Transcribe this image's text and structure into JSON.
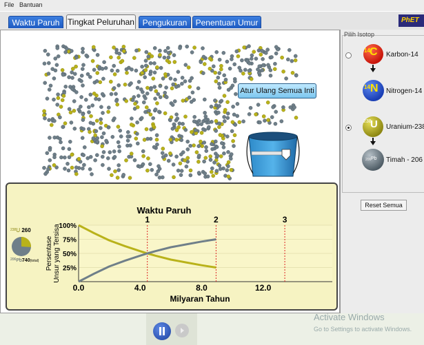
{
  "menu": {
    "file": "File",
    "help": "Bantuan"
  },
  "tabs": [
    {
      "label": "Waktu Paruh",
      "active": false
    },
    {
      "label": "Tingkat Peluruhan",
      "active": true
    },
    {
      "label": "Pengukuran",
      "active": false
    },
    {
      "label": "Penentuan Umur",
      "active": false
    }
  ],
  "logo_text": "PhET",
  "sim": {
    "reset_nuclei_label": "Atur Ulang Semua Inti",
    "colors": {
      "uranium": "#b9b21a",
      "lead": "#6f7f89"
    }
  },
  "chart": {
    "pie": {
      "top_isotope": "U",
      "top_mass": "238",
      "top_count": "260",
      "bottom_isotope": "Pb",
      "bottom_mass": "206",
      "bottom_count": "740",
      "bottom_suffix": "(total)"
    }
  },
  "chart_data": {
    "type": "line",
    "title": "Waktu Paruh",
    "xlabel": "Milyaran Tahun",
    "ylabel": [
      "Persentase",
      "Unsur yang Tersisa"
    ],
    "xlim": [
      0,
      16.5
    ],
    "ylim": [
      0,
      100
    ],
    "x_ticks": [
      "0.0",
      "4.0",
      "8.0",
      "12.0"
    ],
    "x_tick_values": [
      0,
      4,
      8,
      12
    ],
    "y_ticks": [
      "25%",
      "50%",
      "75%",
      "100%"
    ],
    "y_tick_values": [
      25,
      50,
      75,
      100
    ],
    "half_life_markers": [
      {
        "label": "1",
        "x": 4.47
      },
      {
        "label": "2",
        "x": 8.94
      },
      {
        "label": "3",
        "x": 13.41
      }
    ],
    "series": [
      {
        "name": "Uranium-238",
        "color": "#b9b21a",
        "x": [
          0,
          1,
          2,
          3,
          4,
          4.47,
          5,
          6,
          7,
          8,
          8.94
        ],
        "values": [
          100,
          86,
          73,
          63,
          54,
          50,
          46,
          39,
          34,
          29,
          25
        ]
      },
      {
        "name": "Timah - 206",
        "color": "#6f7f89",
        "x": [
          0,
          1,
          2,
          3,
          4,
          4.47,
          5,
          6,
          7,
          8,
          8.94
        ],
        "values": [
          0,
          14,
          27,
          37,
          46,
          50,
          54,
          61,
          66,
          71,
          75
        ]
      }
    ]
  },
  "isotope_panel": {
    "title": "Pilih Isotop",
    "options": [
      {
        "parent_symbol": "C",
        "parent_mass": "14",
        "parent_label": "Karbon-14",
        "daughter_symbol": "N",
        "daughter_mass": "14",
        "daughter_label": "Nitrogen-14",
        "selected": false
      },
      {
        "parent_symbol": "U",
        "parent_mass": "238",
        "parent_label": "Uranium-238",
        "daughter_symbol": "Pb",
        "daughter_mass": "206",
        "daughter_label": "Timah - 206",
        "selected": true
      }
    ],
    "reset_all_label": "Reset Semua"
  },
  "watermark": {
    "line1": "Activate Windows",
    "line2": "Go to Settings to activate Windows."
  }
}
